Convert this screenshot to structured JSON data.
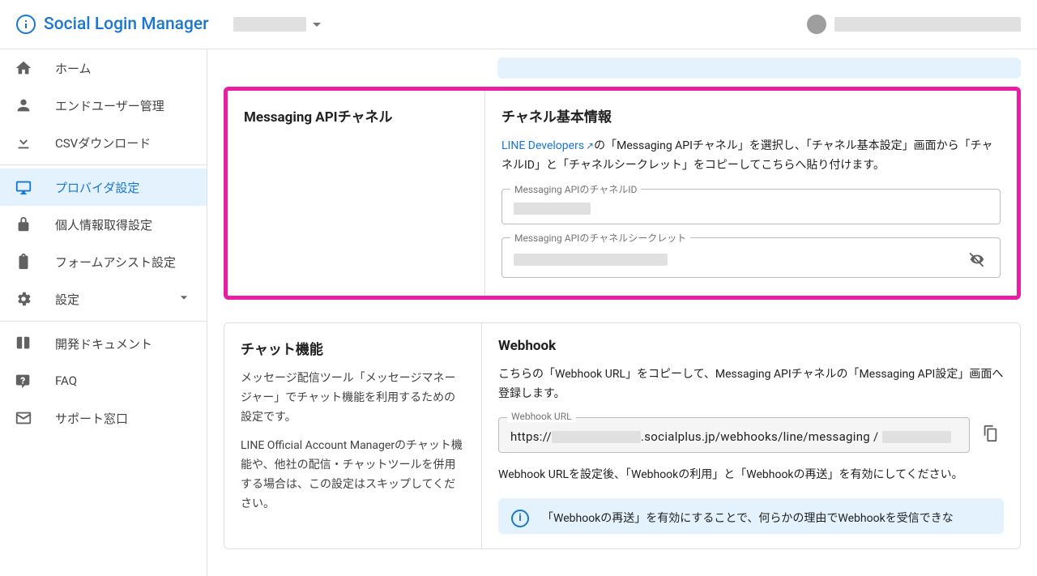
{
  "header": {
    "app_title": "Social Login Manager"
  },
  "sidebar": {
    "items": [
      {
        "id": "home",
        "label": "ホーム"
      },
      {
        "id": "end-users",
        "label": "エンドユーザー管理"
      },
      {
        "id": "csv-download",
        "label": "CSVダウンロード"
      },
      {
        "id": "provider-settings",
        "label": "プロバイダ設定"
      },
      {
        "id": "personal-info",
        "label": "個人情報取得設定"
      },
      {
        "id": "form-assist",
        "label": "フォームアシスト設定"
      },
      {
        "id": "settings",
        "label": "設定"
      },
      {
        "id": "dev-docs",
        "label": "開発ドキュメント"
      },
      {
        "id": "faq",
        "label": "FAQ"
      },
      {
        "id": "support",
        "label": "サポート窓口"
      }
    ]
  },
  "sections": {
    "messaging_api": {
      "left_title": "Messaging APIチャネル",
      "right_title": "チャネル基本情報",
      "link_text": "LINE Developers",
      "desc_after_link": "の「Messaging APIチャネル」を選択し、「チャネル基本設定」画面から「チャネルID」と「チャネルシークレット」をコピーしてこちらへ貼り付けます。",
      "field_channel_id_label": "Messaging APIのチャネルID",
      "field_channel_secret_label": "Messaging APIのチャネルシークレット"
    },
    "chat": {
      "left_title": "チャット機能",
      "left_p1": "メッセージ配信ツール「メッセージマネージャー」でチャット機能を利用するための設定です。",
      "left_p2": "LINE Official Account Managerのチャット機能や、他社の配信・チャットツールを併用する場合は、この設定はスキップしてください。",
      "right_title": "Webhook",
      "desc": "こちらの「Webhook URL」をコピーして、Messaging APIチャネルの「Messaging API設定」画面へ登録します。",
      "webhook_label": "Webhook URL",
      "webhook_url_pre": "https://",
      "webhook_url_mid": ".socialplus.jp/webhooks/line/messaging /",
      "after_webhook_note": "Webhook URLを設定後、「Webhookの利用」と「Webhookの再送」を有効にしてください。",
      "callout_text": "「Webhookの再送」を有効にすることで、何らかの理由でWebhookを受信できな"
    }
  }
}
